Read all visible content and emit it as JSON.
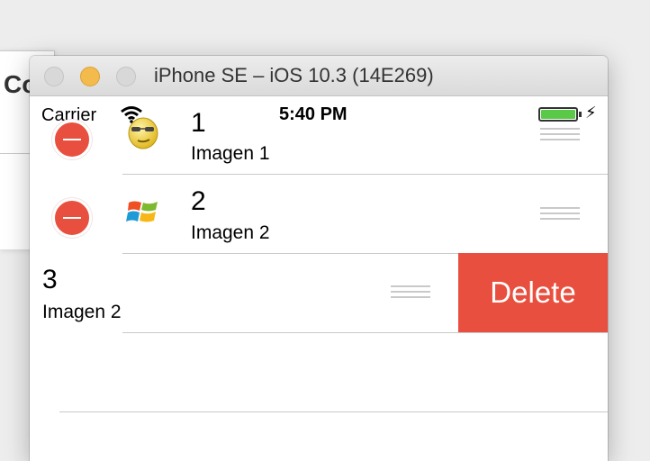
{
  "background_window": {
    "partial_text": "Co"
  },
  "simulator": {
    "title": "iPhone SE – iOS 10.3 (14E269)",
    "status_bar": {
      "carrier": "Carrier",
      "time": "5:40 PM",
      "battery_level": 1.0
    }
  },
  "rows": [
    {
      "title": "1",
      "subtitle": "Imagen 1",
      "icon": "emoji-face-icon",
      "editing": true
    },
    {
      "title": "2",
      "subtitle": "Imagen 2",
      "icon": "windows-logo-icon",
      "editing": true
    },
    {
      "title": "3",
      "subtitle": "Imagen 2",
      "icon": null,
      "editing": false,
      "swiped": true
    }
  ],
  "delete_action": {
    "label": "Delete"
  },
  "colors": {
    "destructive": "#e94f3e",
    "battery": "#5ac948"
  }
}
